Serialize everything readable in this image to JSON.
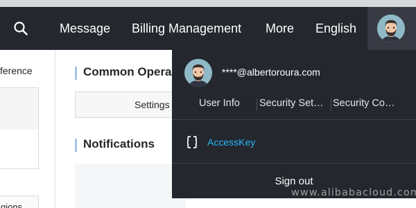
{
  "nav": {
    "search_icon": "search-icon",
    "items": [
      {
        "label": "Message"
      },
      {
        "label": "Billing Management"
      },
      {
        "label": "More"
      },
      {
        "label": "English"
      }
    ],
    "avatar_icon": "user-avatar"
  },
  "left": {
    "text_partial": "ference",
    "bottom_text_partial": "gions"
  },
  "main": {
    "common_title": "Common Opera",
    "settings_label": "Settings",
    "notifications_title": "Notifications"
  },
  "dropdown": {
    "email": "****@albertoroura.com",
    "links": [
      {
        "label": "User Info"
      },
      {
        "label": "Security Set…"
      },
      {
        "label": "Security Co…"
      }
    ],
    "accesskey_label": "AccessKey",
    "accesskey_icon": "code-brackets-icon",
    "signout_label": "Sign out"
  },
  "watermark": "www.alibabacloud.com",
  "colors": {
    "navbar": "#24272e",
    "accent": "#29b6f6",
    "section_bar": "#a5c3e6"
  }
}
